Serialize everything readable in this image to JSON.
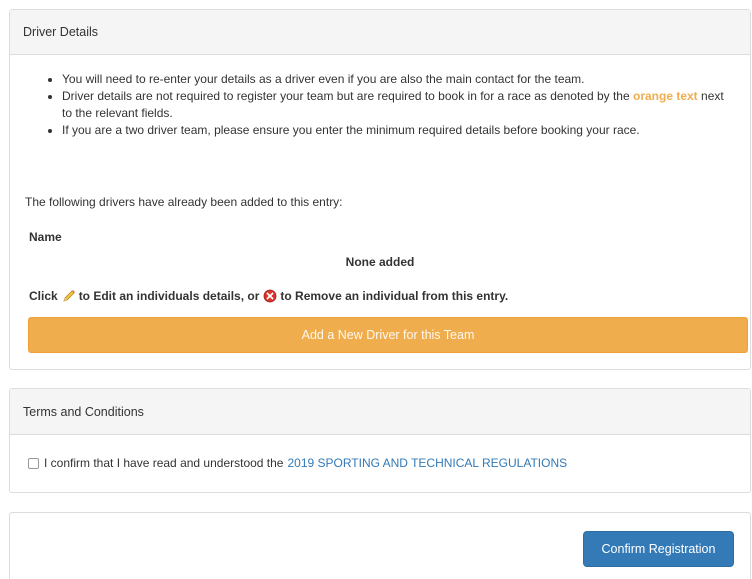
{
  "driver_panel": {
    "heading": "Driver Details",
    "notes": [
      "You will need to re-enter your details as a driver even if you are also the main contact for the team.",
      {
        "before": "Driver details are not required to register your team but are required to book in for a race as denoted by the",
        "highlight": "orange text",
        "after": "next to the relevant fields."
      },
      "If you are a two driver team, please ensure you enter the minimum required details before booking your race."
    ],
    "intro_text": "The following drivers have already been added to this entry:",
    "table_header_name": "Name",
    "empty_text": "None added",
    "instructions": {
      "prefix": "Click",
      "middle": "to Edit an individuals details, or",
      "suffix": "to Remove an individual from this entry."
    },
    "add_button_label": "Add a New Driver for this Team"
  },
  "terms_panel": {
    "heading": "Terms and Conditions",
    "checkbox_checked": false,
    "confirm_text": "I confirm that I have read and understood the",
    "link_text": "2019 SPORTING AND TECHNICAL REGULATIONS"
  },
  "footer": {
    "confirm_button_label": "Confirm Registration"
  },
  "colors": {
    "orange": "#f0ad4e",
    "blue": "#337ab7"
  },
  "icons": {
    "edit": "pencil-icon",
    "remove": "remove-icon"
  }
}
